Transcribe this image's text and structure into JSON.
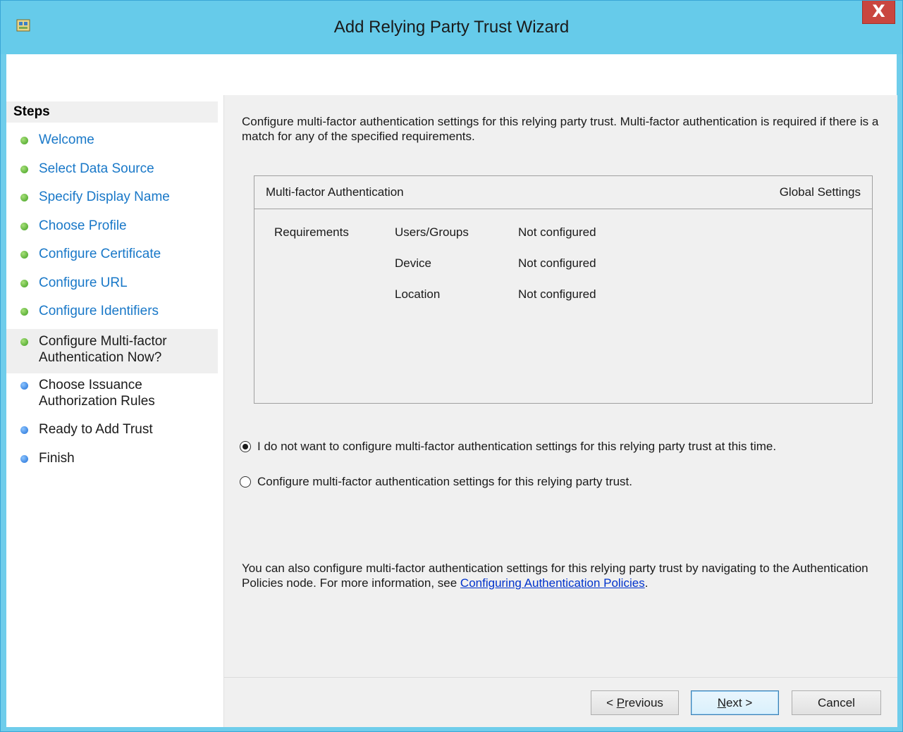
{
  "window": {
    "title": "Add Relying Party Trust Wizard",
    "close_label": "X"
  },
  "steps": {
    "heading": "Steps",
    "items": [
      {
        "label": "Welcome",
        "status": "done"
      },
      {
        "label": "Select Data Source",
        "status": "done"
      },
      {
        "label": "Specify Display Name",
        "status": "done"
      },
      {
        "label": "Choose Profile",
        "status": "done"
      },
      {
        "label": "Configure Certificate",
        "status": "done"
      },
      {
        "label": "Configure URL",
        "status": "done"
      },
      {
        "label": "Configure Identifiers",
        "status": "done"
      },
      {
        "label": "Configure Multi-factor Authentication Now?",
        "status": "current"
      },
      {
        "label": "Choose Issuance Authorization Rules",
        "status": "pending"
      },
      {
        "label": "Ready to Add Trust",
        "status": "pending"
      },
      {
        "label": "Finish",
        "status": "pending"
      }
    ]
  },
  "main": {
    "intro": "Configure multi-factor authentication settings for this relying party trust. Multi-factor authentication is required if there is a match for any of the specified requirements.",
    "mfa_table": {
      "header_left": "Multi-factor Authentication",
      "header_right": "Global Settings",
      "requirements_label": "Requirements",
      "rows": [
        {
          "name": "Users/Groups",
          "value": "Not configured"
        },
        {
          "name": "Device",
          "value": "Not configured"
        },
        {
          "name": "Location",
          "value": "Not configured"
        }
      ]
    },
    "options": [
      {
        "label": "I do not want to configure multi-factor authentication settings for this relying party trust at this time.",
        "selected": true
      },
      {
        "label": "Configure multi-factor authentication settings for this relying party trust.",
        "selected": false
      }
    ],
    "help_text": "You can also configure multi-factor authentication settings for this relying party trust by navigating to the Authentication Policies node. For more information, see ",
    "help_link": "Configuring Authentication Policies",
    "help_suffix": "."
  },
  "buttons": {
    "previous_prefix": "< ",
    "previous_mnemonic": "P",
    "previous_rest": "revious",
    "next_mnemonic": "N",
    "next_rest": "ext >",
    "cancel": "Cancel"
  },
  "colors": {
    "titlebar": "#66cbea",
    "link": "#1978c8",
    "close": "#c9463f"
  }
}
